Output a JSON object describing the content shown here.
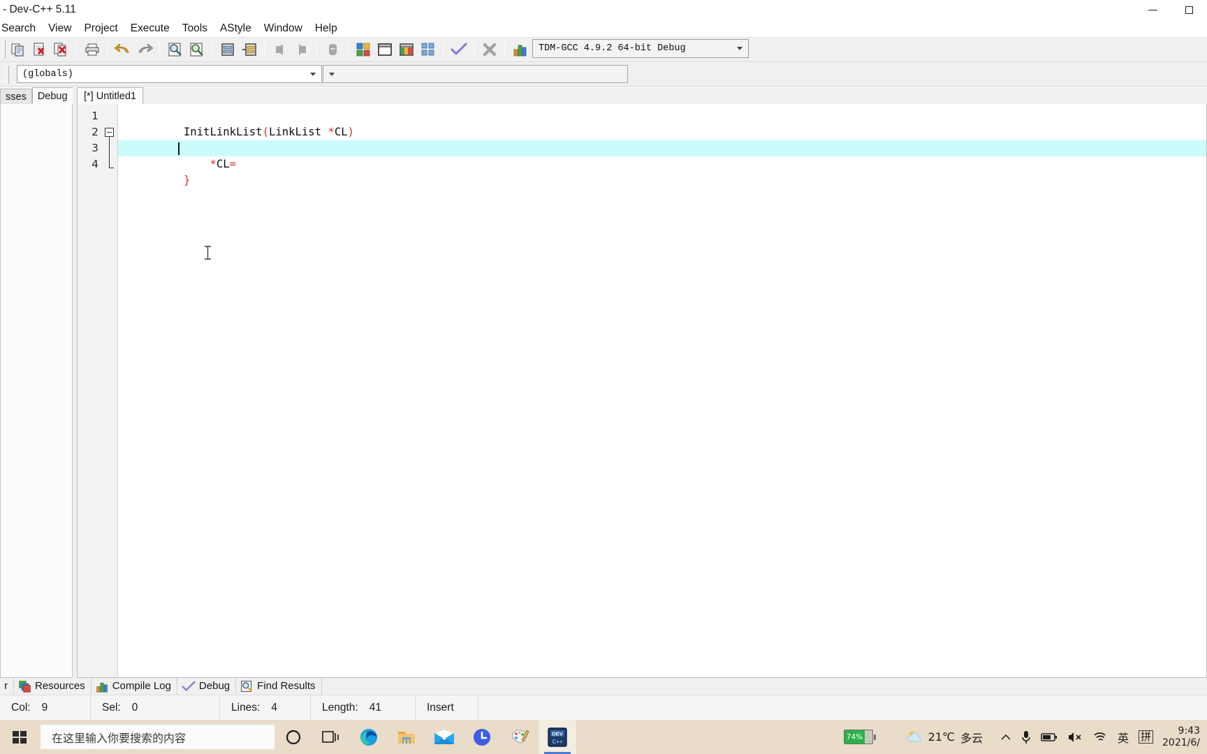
{
  "window": {
    "title": "- Dev-C++ 5.11",
    "minimize_label": "minimize",
    "maximize_label": "maximize"
  },
  "menu": {
    "items": [
      {
        "label": "Search"
      },
      {
        "label": "View"
      },
      {
        "label": "Project"
      },
      {
        "label": "Execute"
      },
      {
        "label": "Tools"
      },
      {
        "label": "AStyle"
      },
      {
        "label": "Window"
      },
      {
        "label": "Help"
      }
    ]
  },
  "toolbar": {
    "buttons": [
      {
        "name": "new-file-button",
        "icon": "new-file-icon"
      },
      {
        "name": "close-file-button",
        "icon": "close-file-icon"
      },
      {
        "name": "close-all-button",
        "icon": "close-all-icon"
      },
      {
        "name": "print-button",
        "icon": "printer-icon"
      },
      {
        "name": "undo-button",
        "icon": "undo-arrow-icon"
      },
      {
        "name": "redo-button",
        "icon": "redo-arrow-icon"
      },
      {
        "name": "find-button",
        "icon": "magnifier-icon"
      },
      {
        "name": "replace-button",
        "icon": "magnifier-replace-icon"
      },
      {
        "name": "goto-line-button",
        "icon": "goto-line-icon"
      },
      {
        "name": "goto-function-button",
        "icon": "goto-function-icon"
      },
      {
        "name": "step-back-button",
        "icon": "step-back-icon"
      },
      {
        "name": "step-forward-button",
        "icon": "step-forward-icon"
      },
      {
        "name": "bookmark-button",
        "icon": "bookmark-icon"
      },
      {
        "name": "compile-button",
        "icon": "compile-icon"
      },
      {
        "name": "run-button",
        "icon": "run-window-icon"
      },
      {
        "name": "compile-run-button",
        "icon": "compile-run-icon"
      },
      {
        "name": "rebuild-all-button",
        "icon": "rebuild-all-icon"
      },
      {
        "name": "syntax-check-button",
        "icon": "check-mark-icon"
      },
      {
        "name": "stop-execution-button",
        "icon": "stop-x-icon"
      },
      {
        "name": "profile-button",
        "icon": "bar-chart-icon"
      },
      {
        "name": "delete-profile-button",
        "icon": "delete-profile-icon"
      }
    ],
    "compiler_set": {
      "value": "TDM-GCC 4.9.2 64-bit Debug",
      "name": "compiler-set-dropdown"
    }
  },
  "class_browser": {
    "scope_combo_value": "(globals)",
    "member_combo_value": ""
  },
  "left_panel": {
    "tabs": [
      {
        "label": "sses",
        "active": false
      },
      {
        "label": "Debug",
        "active": true
      }
    ]
  },
  "editor": {
    "tabs": [
      {
        "label": "[*] Untitled1",
        "active": true
      }
    ],
    "lines": [
      {
        "number": "1",
        "tokens": [
          {
            "text": "InitLinkList",
            "color": "dark"
          },
          {
            "text": "(",
            "color": "red"
          },
          {
            "text": "LinkList ",
            "color": "dark"
          },
          {
            "text": "*",
            "color": "red"
          },
          {
            "text": "CL",
            "color": "dark"
          },
          {
            "text": ")",
            "color": "red"
          }
        ],
        "highlight": false,
        "fold": "open"
      },
      {
        "number": "2",
        "tokens": [
          {
            "text": "{",
            "color": "red"
          }
        ],
        "highlight": false
      },
      {
        "number": "3",
        "tokens": [
          {
            "text": "    ",
            "color": "dark"
          },
          {
            "text": "*",
            "color": "red"
          },
          {
            "text": "CL",
            "color": "dark"
          },
          {
            "text": "=",
            "color": "red"
          }
        ],
        "highlight": true
      },
      {
        "number": "4",
        "tokens": [
          {
            "text": "}",
            "color": "red"
          }
        ],
        "highlight": false
      }
    ],
    "caret_line": 3,
    "highlight_color": "#ccfbfb",
    "keyword_color": "#d33232",
    "text_color": "#101010"
  },
  "bottom_panel": {
    "tabs": [
      {
        "label": "r",
        "icon": "compiler-icon",
        "show_icon": false
      },
      {
        "label": "Resources",
        "icon": "resources-icon",
        "show_icon": true
      },
      {
        "label": "Compile Log",
        "icon": "bar-chart-icon",
        "show_icon": true
      },
      {
        "label": "Debug",
        "icon": "check-mark-icon",
        "show_icon": true
      },
      {
        "label": "Find Results",
        "icon": "magnifier-icon",
        "show_icon": true
      }
    ]
  },
  "statusbar": {
    "cells": [
      {
        "key": "Col:",
        "value": "9"
      },
      {
        "key": "Sel:",
        "value": "0"
      },
      {
        "key": "Lines:",
        "value": "4"
      },
      {
        "key": "Length:",
        "value": "41"
      },
      {
        "key": "",
        "value": "Insert"
      }
    ]
  },
  "taskbar": {
    "search_placeholder": "在这里输入你要搜索的内容",
    "items": [
      {
        "name": "cortana-button",
        "icon": "circle-icon"
      },
      {
        "name": "task-view-button",
        "icon": "task-view-icon"
      },
      {
        "name": "edge-button",
        "icon": "edge-icon"
      },
      {
        "name": "file-explorer-button",
        "icon": "folder-icon"
      },
      {
        "name": "mail-button",
        "icon": "mail-icon"
      },
      {
        "name": "clock-app-button",
        "icon": "clock-app-icon"
      },
      {
        "name": "paint-button",
        "icon": "paint-palette-icon"
      },
      {
        "name": "devcpp-button",
        "icon": "devcpp-icon",
        "active": true
      }
    ],
    "tray": {
      "battery_percent": "74%",
      "weather_temp": "21℃",
      "weather_desc": "多云",
      "ime_lang": "英",
      "ime_mode": "拼",
      "time": "9:43",
      "date": "2021/6/"
    }
  }
}
